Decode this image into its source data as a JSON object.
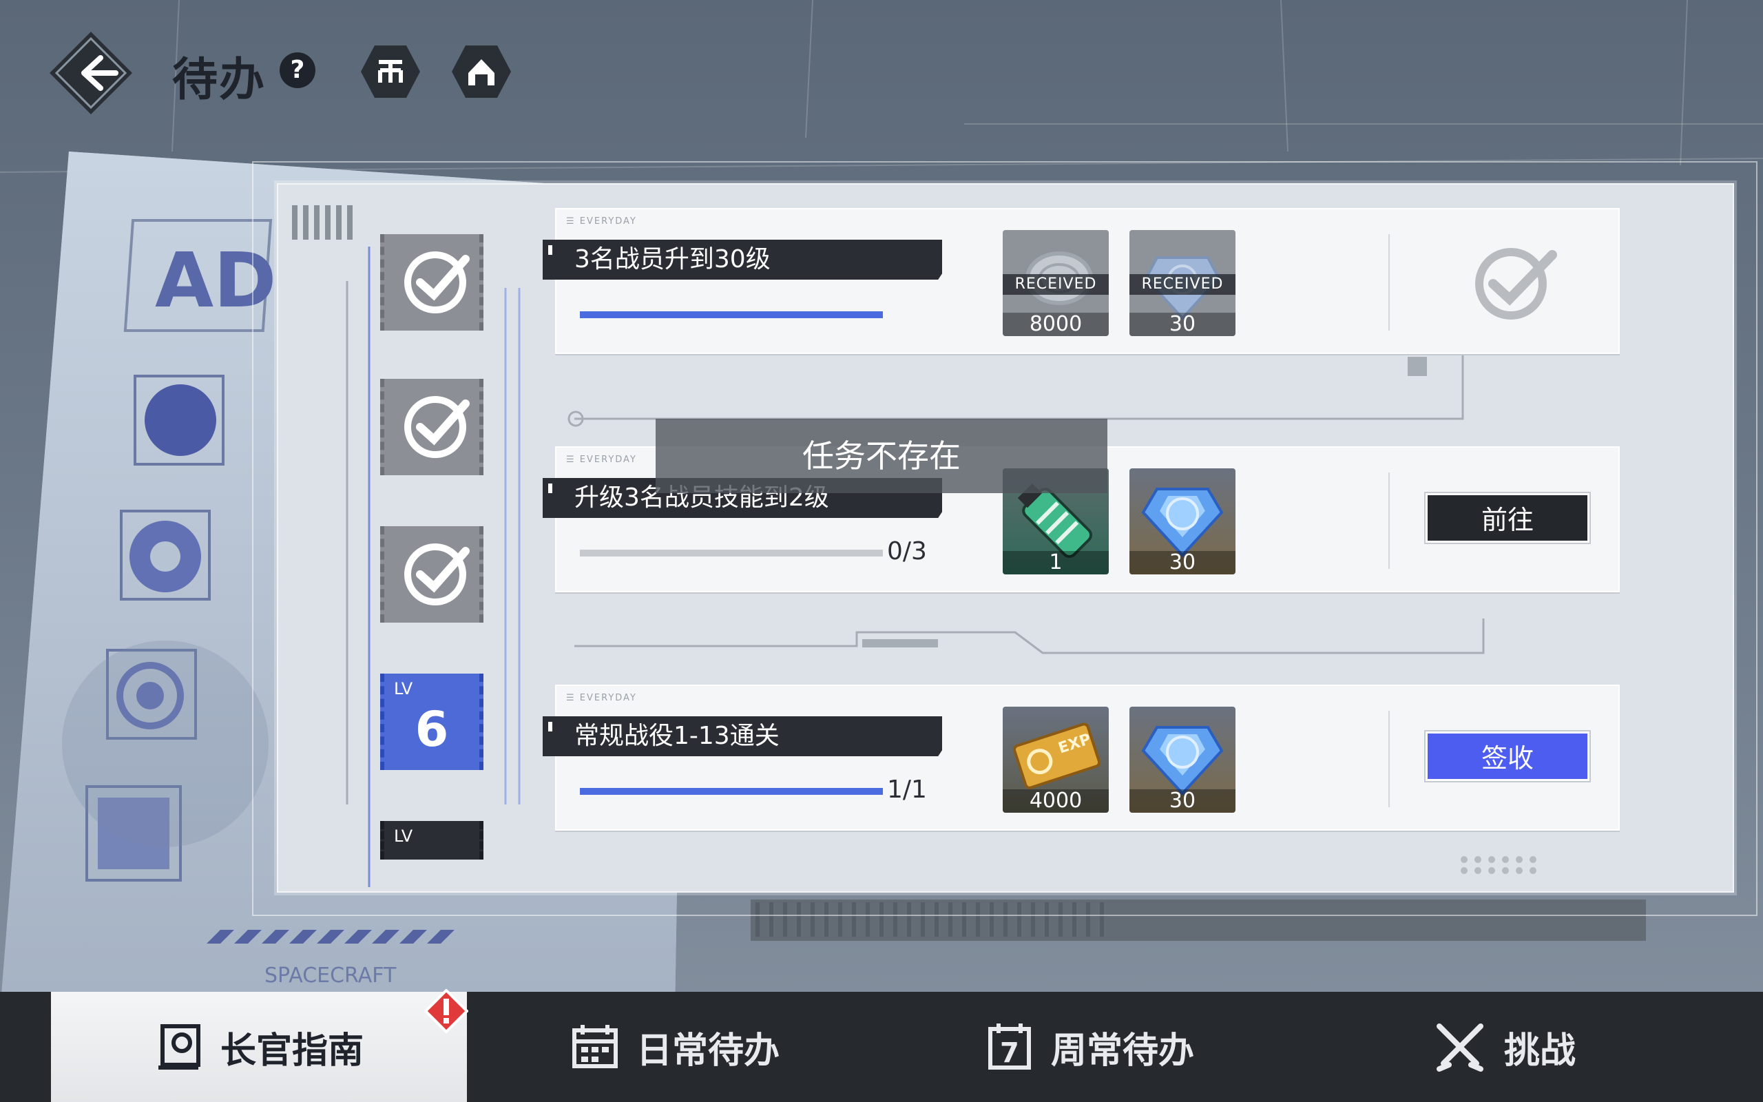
{
  "header": {
    "title": "待办",
    "help_label": "?"
  },
  "toast": "任务不存在",
  "levels": [
    {
      "state": "done"
    },
    {
      "state": "done"
    },
    {
      "state": "done"
    },
    {
      "state": "current",
      "lv_label": "LV",
      "value": "6"
    },
    {
      "state": "locked",
      "lv_label": "LV"
    }
  ],
  "tasks": [
    {
      "tag": "EVERYDAY",
      "name": "3名战员升到30级",
      "progress": 1.0,
      "progress_text": "",
      "rewards": [
        {
          "icon": "silver-coin-icon",
          "qty": "8000",
          "received_label": "RECEIVED"
        },
        {
          "icon": "blue-crystal-icon",
          "qty": "30",
          "received_label": "RECEIVED"
        }
      ],
      "action": {
        "type": "completed-check",
        "label": ""
      }
    },
    {
      "tag": "EVERYDAY",
      "name": "升级3名战员技能到2级",
      "progress": 0.0,
      "progress_text": "0/3",
      "rewards": [
        {
          "icon": "green-canister-icon",
          "qty": "1"
        },
        {
          "icon": "blue-crystal-icon",
          "qty": "30"
        }
      ],
      "action": {
        "type": "go",
        "label": "前往"
      }
    },
    {
      "tag": "EVERYDAY",
      "name": "常规战役1-13通关",
      "progress": 1.0,
      "progress_text": "1/1",
      "rewards": [
        {
          "icon": "exp-ticket-icon",
          "qty": "4000"
        },
        {
          "icon": "blue-crystal-icon",
          "qty": "30"
        }
      ],
      "action": {
        "type": "claim",
        "label": "签收"
      }
    }
  ],
  "tabs": [
    {
      "label": "长官指南",
      "icon": "guide-book-icon",
      "active": true
    },
    {
      "label": "日常待办",
      "icon": "calendar-icon",
      "active": false
    },
    {
      "label": "周常待办",
      "icon": "weekly-calendar-icon",
      "active": false
    },
    {
      "label": "挑战",
      "icon": "crossed-swords-icon",
      "active": false
    }
  ],
  "poster": {
    "text": "SPACECRAFT"
  },
  "colors": {
    "accent_blue": "#4d5df0",
    "progress_blue": "#4b6be0",
    "dark": "#24272c",
    "alert_red": "#e03a3a"
  }
}
